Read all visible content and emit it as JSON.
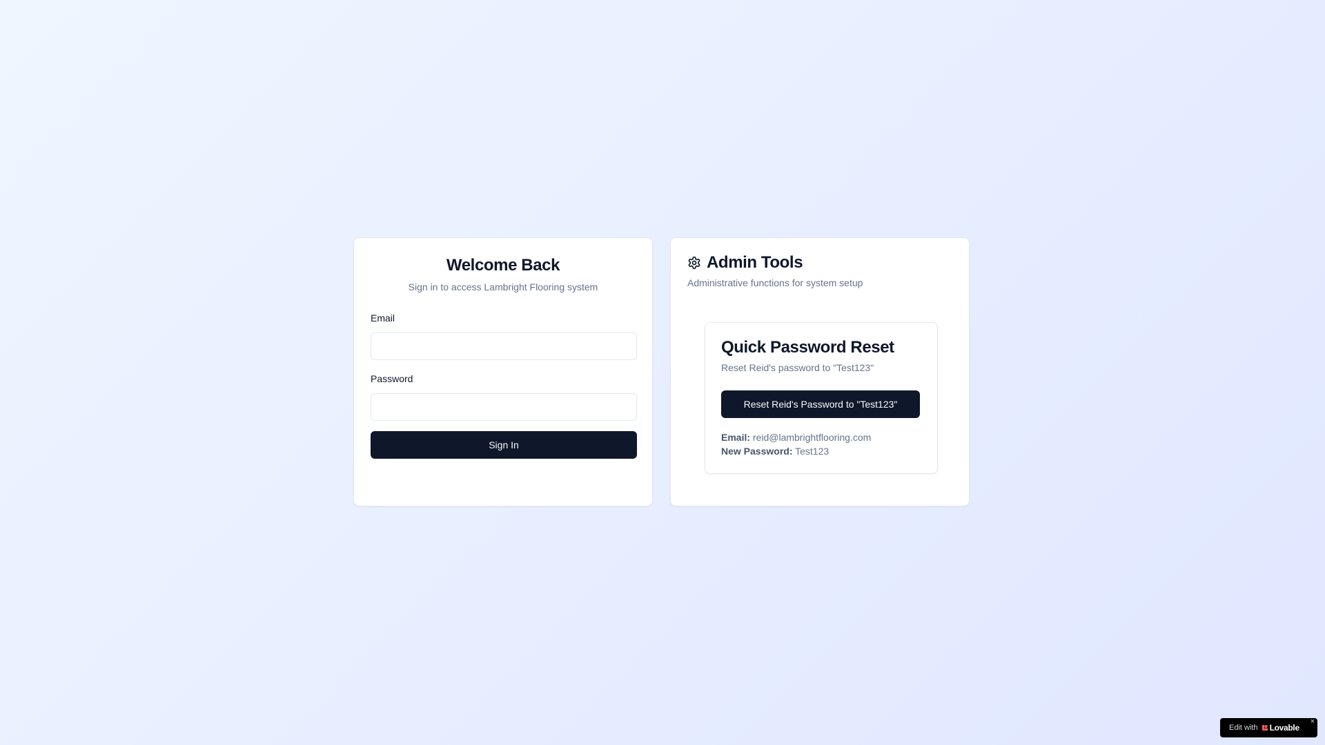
{
  "login": {
    "title": "Welcome Back",
    "subtitle": "Sign in to access Lambright Flooring system",
    "email_label": "Email",
    "email_value": "",
    "password_label": "Password",
    "password_value": "",
    "submit_label": "Sign In"
  },
  "admin": {
    "icon": "gear-icon",
    "title": "Admin Tools",
    "subtitle": "Administrative functions for system setup",
    "reset_card": {
      "title": "Quick Password Reset",
      "subtitle": "Reset Reid's password to \"Test123\"",
      "button_label": "Reset Reid's Password to \"Test123\"",
      "email_label": "Email:",
      "email_value": "reid@lambrightflooring.com",
      "password_label": "New Password:",
      "password_value": "Test123"
    }
  },
  "badge": {
    "prefix": "Edit with",
    "brand": "Lovable",
    "close": "×",
    "icon": "heart-icon"
  },
  "colors": {
    "primary": "#0f172a",
    "muted_text": "#64748b",
    "border": "#e2e8f0",
    "background_from": "#eff6ff",
    "background_to": "#e0e7ff"
  }
}
